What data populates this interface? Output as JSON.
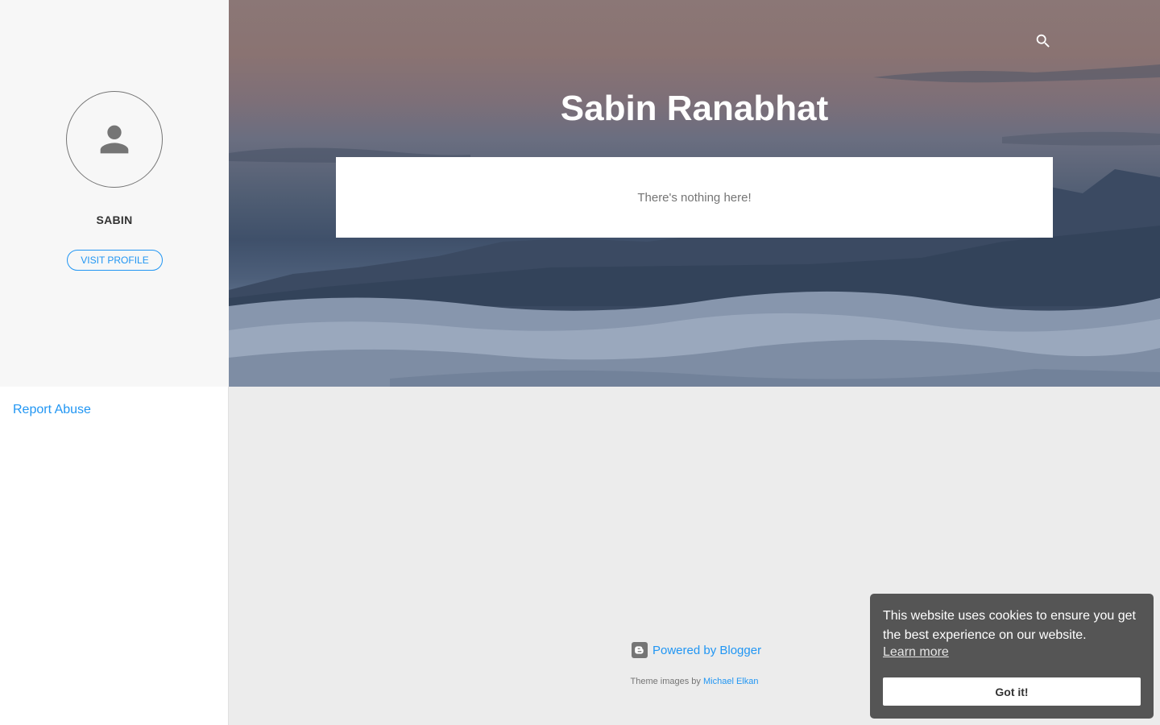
{
  "sidebar": {
    "profile_name": "SABIN",
    "visit_profile_label": "VISIT PROFILE",
    "report_abuse_label": "Report Abuse"
  },
  "header": {
    "blog_title": "Sabin Ranabhat",
    "search_icon": "search-icon"
  },
  "main": {
    "empty_message": "There's nothing here!"
  },
  "footer": {
    "powered_by_label": "Powered by Blogger",
    "theme_images_prefix": "Theme images by",
    "theme_images_author": "Michael Elkan"
  },
  "cookie_banner": {
    "message": "This website uses cookies to ensure you get the best experience on our website.",
    "learn_more_label": "Learn more",
    "accept_label": "Got it!"
  },
  "colors": {
    "accent": "#2196f3",
    "sidebar_bg": "#f7f7f7",
    "page_bg": "#ececec",
    "cookie_bg": "#555555"
  }
}
